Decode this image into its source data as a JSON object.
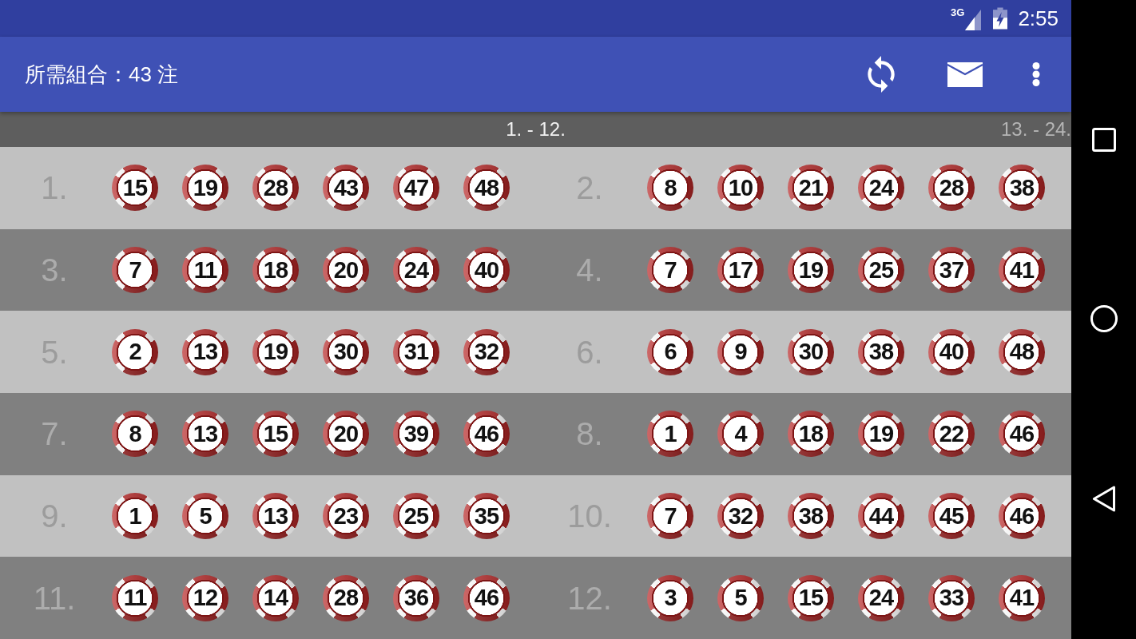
{
  "status_bar": {
    "network": "3G",
    "time": "2:55"
  },
  "app_bar": {
    "title": "所需組合：43 注"
  },
  "pages": [
    {
      "label": "1. - 12.",
      "selected": true
    },
    {
      "label": "13. - 24.",
      "selected": false
    }
  ],
  "combinations": [
    {
      "label": "1.",
      "numbers": [
        "15",
        "19",
        "28",
        "43",
        "47",
        "48"
      ]
    },
    {
      "label": "2.",
      "numbers": [
        "8",
        "10",
        "21",
        "24",
        "28",
        "38"
      ]
    },
    {
      "label": "3.",
      "numbers": [
        "7",
        "11",
        "18",
        "20",
        "24",
        "40"
      ]
    },
    {
      "label": "4.",
      "numbers": [
        "7",
        "17",
        "19",
        "25",
        "37",
        "41"
      ]
    },
    {
      "label": "5.",
      "numbers": [
        "2",
        "13",
        "19",
        "30",
        "31",
        "32"
      ]
    },
    {
      "label": "6.",
      "numbers": [
        "6",
        "9",
        "30",
        "38",
        "40",
        "48"
      ]
    },
    {
      "label": "7.",
      "numbers": [
        "8",
        "13",
        "15",
        "20",
        "39",
        "46"
      ]
    },
    {
      "label": "8.",
      "numbers": [
        "1",
        "4",
        "18",
        "19",
        "22",
        "46"
      ]
    },
    {
      "label": "9.",
      "numbers": [
        "1",
        "5",
        "13",
        "23",
        "25",
        "35"
      ]
    },
    {
      "label": "10.",
      "numbers": [
        "7",
        "32",
        "38",
        "44",
        "45",
        "46"
      ]
    },
    {
      "label": "11.",
      "numbers": [
        "11",
        "12",
        "14",
        "28",
        "36",
        "46"
      ]
    },
    {
      "label": "12.",
      "numbers": [
        "3",
        "5",
        "15",
        "24",
        "33",
        "41"
      ]
    }
  ]
}
